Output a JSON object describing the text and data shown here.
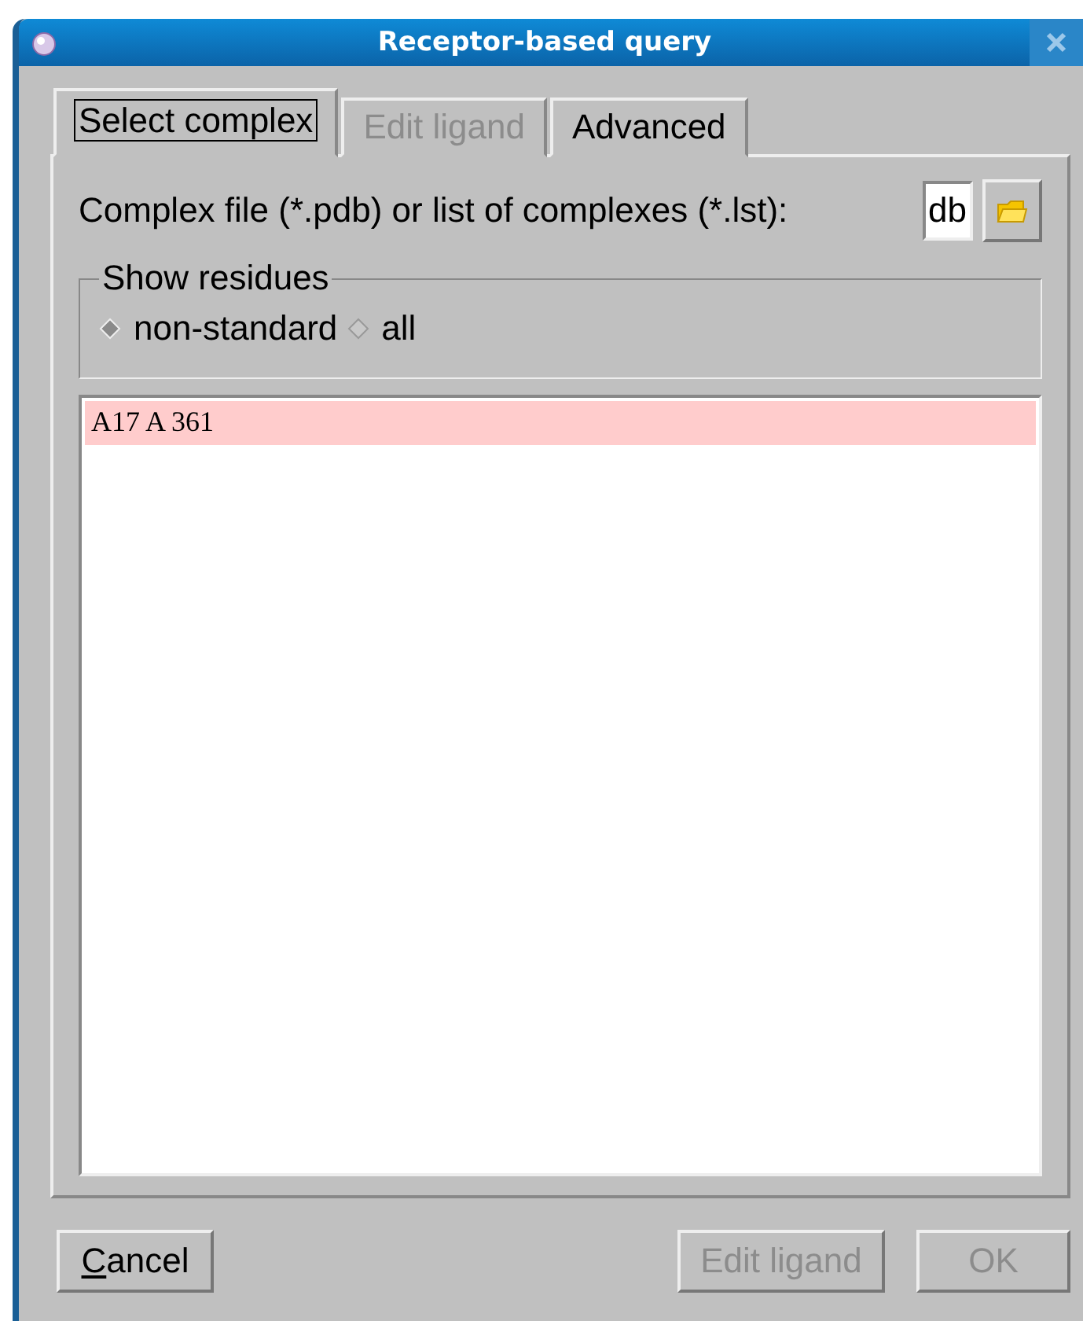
{
  "window": {
    "title": "Receptor-based query"
  },
  "tabs": [
    {
      "label": "Select complex",
      "selected": true,
      "disabled": false
    },
    {
      "label": "Edit ligand",
      "selected": false,
      "disabled": true
    },
    {
      "label": "Advanced",
      "selected": false,
      "disabled": false
    }
  ],
  "file_field": {
    "label": "Complex file (*.pdb) or list of complexes (*.lst):",
    "value": "db"
  },
  "show_residues": {
    "title": "Show residues",
    "options": [
      {
        "label": "non-standard",
        "selected": true
      },
      {
        "label": "all",
        "selected": false
      }
    ]
  },
  "residues": [
    {
      "text": "A17 A 361",
      "selected": true
    }
  ],
  "buttons": [
    {
      "label": "Cancel",
      "disabled": false,
      "underline_first": true
    },
    {
      "label": "Edit ligand",
      "disabled": true,
      "underline_first": false
    },
    {
      "label": "OK",
      "disabled": true,
      "underline_first": false
    }
  ]
}
